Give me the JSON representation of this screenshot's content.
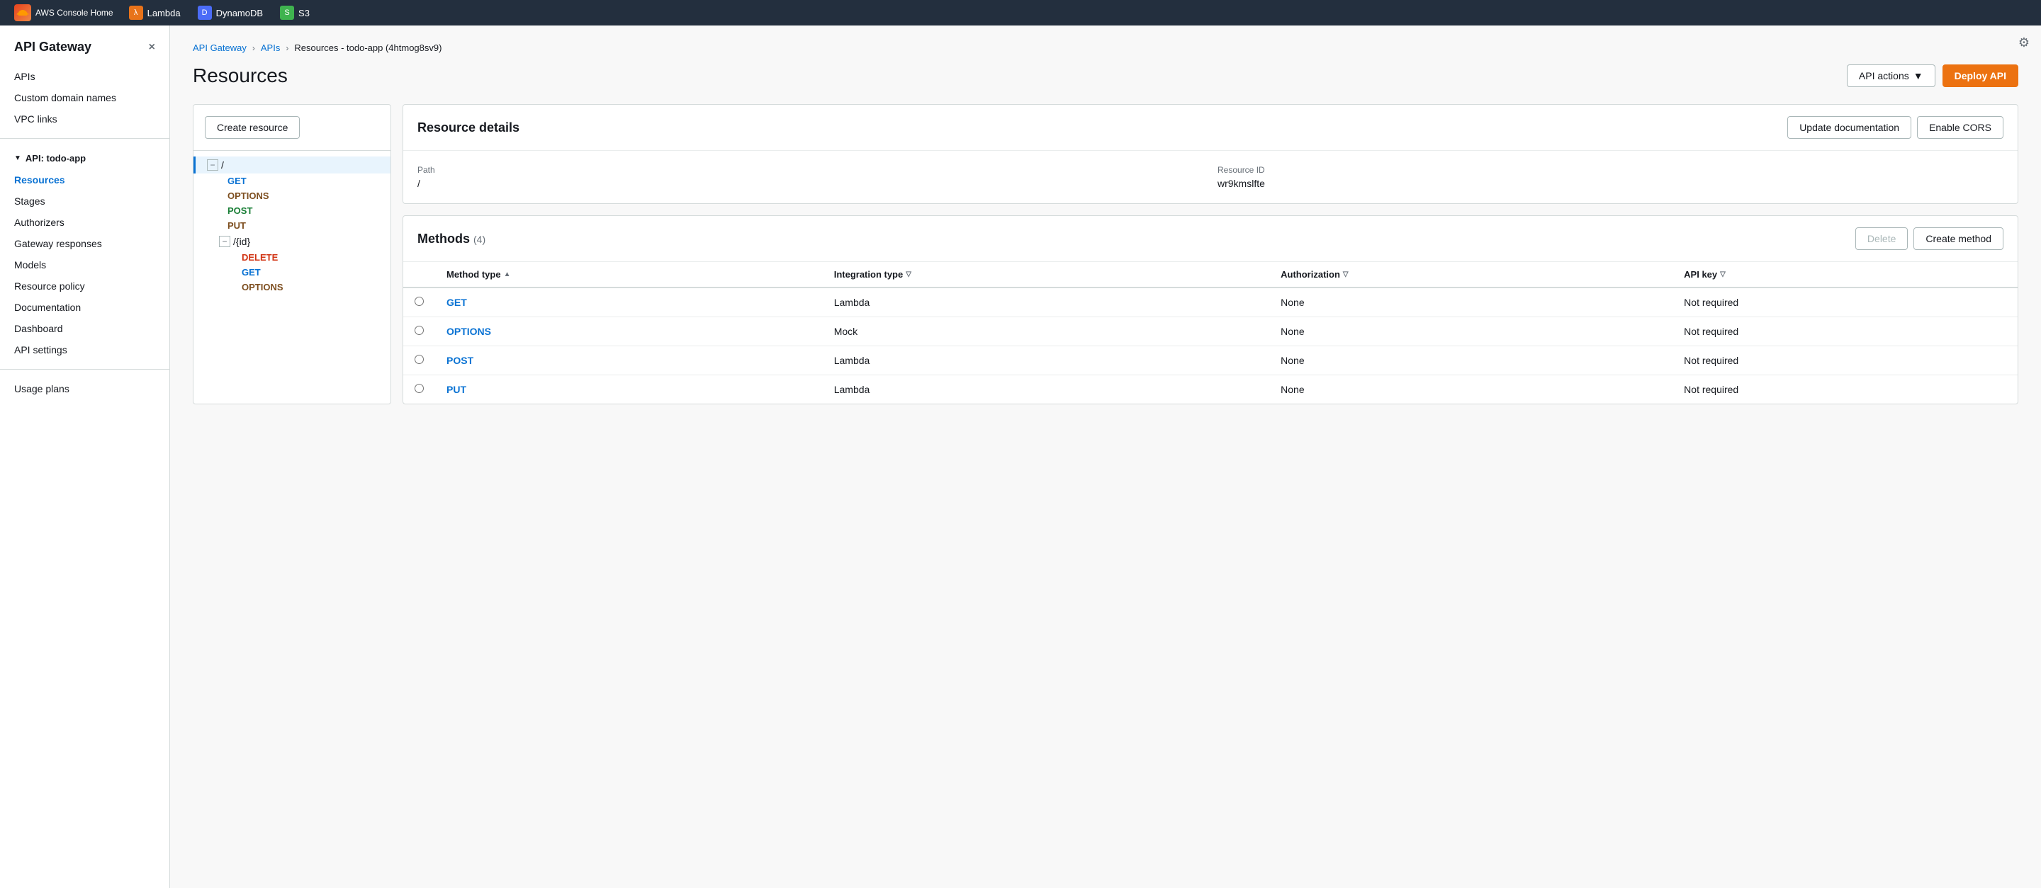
{
  "topbar": {
    "logo_text": "AWS Console Home",
    "services": [
      {
        "name": "Lambda",
        "icon": "λ",
        "color": "#e8731a"
      },
      {
        "name": "DynamoDB",
        "icon": "D",
        "color": "#4b6cf7"
      },
      {
        "name": "S3",
        "icon": "S",
        "color": "#3fb34f"
      }
    ]
  },
  "sidebar": {
    "title": "API Gateway",
    "close_label": "×",
    "nav_items": [
      {
        "label": "APIs",
        "active": false
      },
      {
        "label": "Custom domain names",
        "active": false
      },
      {
        "label": "VPC links",
        "active": false
      }
    ],
    "api_section": "API: todo-app",
    "api_nav_items": [
      {
        "label": "Resources",
        "active": true
      },
      {
        "label": "Stages",
        "active": false
      },
      {
        "label": "Authorizers",
        "active": false
      },
      {
        "label": "Gateway responses",
        "active": false
      },
      {
        "label": "Models",
        "active": false
      },
      {
        "label": "Resource policy",
        "active": false
      },
      {
        "label": "Documentation",
        "active": false
      },
      {
        "label": "Dashboard",
        "active": false
      },
      {
        "label": "API settings",
        "active": false
      }
    ],
    "bottom_nav_items": [
      {
        "label": "Usage plans",
        "active": false
      }
    ]
  },
  "breadcrumb": {
    "items": [
      {
        "label": "API Gateway",
        "link": true
      },
      {
        "label": "APIs",
        "link": true
      },
      {
        "label": "Resources - todo-app (4htmog8sv9)",
        "link": false
      }
    ]
  },
  "page": {
    "title": "Resources",
    "actions": {
      "api_actions_label": "API actions",
      "deploy_api_label": "Deploy API"
    }
  },
  "resource_tree": {
    "create_resource_label": "Create resource",
    "items": [
      {
        "type": "root",
        "path": "/",
        "expanded": true,
        "selected": true
      },
      {
        "type": "method",
        "label": "GET",
        "color": "get",
        "parent": "/"
      },
      {
        "type": "method",
        "label": "OPTIONS",
        "color": "options",
        "parent": "/"
      },
      {
        "type": "method",
        "label": "POST",
        "color": "post",
        "parent": "/"
      },
      {
        "type": "method",
        "label": "PUT",
        "color": "put",
        "parent": "/"
      },
      {
        "type": "resource",
        "path": "/{id}",
        "expanded": true,
        "selected": false
      },
      {
        "type": "method",
        "label": "DELETE",
        "color": "delete",
        "parent": "/{id}"
      },
      {
        "type": "method",
        "label": "GET",
        "color": "get",
        "parent": "/{id}"
      },
      {
        "type": "method",
        "label": "OPTIONS",
        "color": "options",
        "parent": "/{id}"
      }
    ]
  },
  "resource_details": {
    "title": "Resource details",
    "update_doc_label": "Update documentation",
    "enable_cors_label": "Enable CORS",
    "path_label": "Path",
    "path_value": "/",
    "resource_id_label": "Resource ID",
    "resource_id_value": "wr9kmslfte"
  },
  "methods": {
    "title": "Methods",
    "count": 4,
    "delete_label": "Delete",
    "create_method_label": "Create method",
    "columns": [
      {
        "label": "Method type",
        "sortable": true
      },
      {
        "label": "Integration type",
        "sortable": true
      },
      {
        "label": "Authorization",
        "sortable": true
      },
      {
        "label": "API key",
        "sortable": true
      }
    ],
    "rows": [
      {
        "method": "GET",
        "integration": "Lambda",
        "authorization": "None",
        "api_key": "Not required"
      },
      {
        "method": "OPTIONS",
        "integration": "Mock",
        "authorization": "None",
        "api_key": "Not required"
      },
      {
        "method": "POST",
        "integration": "Lambda",
        "authorization": "None",
        "api_key": "Not required"
      },
      {
        "method": "PUT",
        "integration": "Lambda",
        "authorization": "None",
        "api_key": "Not required"
      }
    ]
  }
}
